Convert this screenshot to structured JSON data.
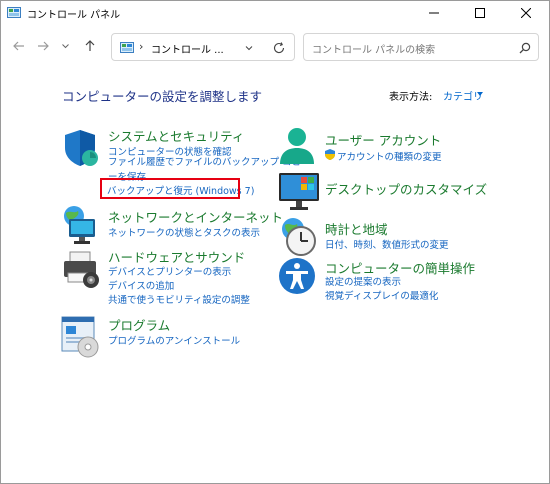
{
  "window": {
    "title": "コントロール パネル",
    "controls": {
      "minimize": "minimize",
      "maximize": "maximize",
      "close": "close"
    }
  },
  "address_bar": {
    "separator": "›",
    "path": "コントロール ...",
    "search_placeholder": "コントロール パネルの検索"
  },
  "header": {
    "heading": "コンピューターの設定を調整します",
    "view_by_label": "表示方法:",
    "view_by_value": "カテゴリ"
  },
  "categories": {
    "system_security": {
      "title": "システムとセキュリティ",
      "links": [
        "コンピューターの状態を確認",
        "ファイル履歴でファイルのバックアップ コピーを保存",
        "バックアップと復元 (Windows 7)"
      ]
    },
    "network": {
      "title": "ネットワークとインターネット",
      "links": [
        "ネットワークの状態とタスクの表示"
      ]
    },
    "hardware": {
      "title": "ハードウェアとサウンド",
      "links": [
        "デバイスとプリンターの表示",
        "デバイスの追加",
        "共通で使うモビリティ設定の調整"
      ]
    },
    "programs": {
      "title": "プログラム",
      "links": [
        "プログラムのアンインストール"
      ]
    },
    "user_accounts": {
      "title": "ユーザー アカウント",
      "links": [
        "アカウントの種類の変更"
      ]
    },
    "appearance": {
      "title": "デスクトップのカスタマイズ",
      "links": []
    },
    "clock_region": {
      "title": "時計と地域",
      "links": [
        "日付、時刻、数値形式の変更"
      ]
    },
    "ease_of_access": {
      "title": "コンピューターの簡単操作",
      "links": [
        "設定の提案の表示",
        "視覚ディスプレイの最適化"
      ]
    }
  },
  "colors": {
    "heading": "#1e3287",
    "category_title": "#1a7a2e",
    "link": "#1565c0",
    "highlight": "#e60012"
  }
}
